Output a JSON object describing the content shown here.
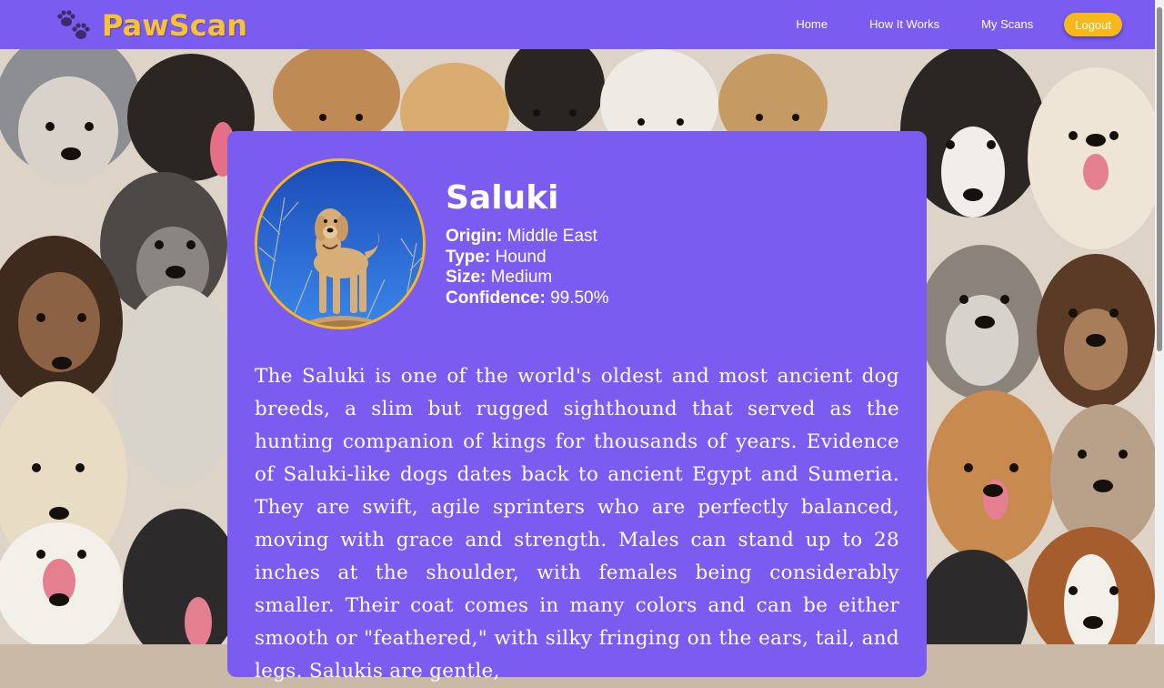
{
  "app": {
    "brand": "PawScan",
    "logo_icon": "paw-prints-icon",
    "accent": "#7a5cf0",
    "brand_color": "#f7c32e",
    "button_color": "#f7b81b"
  },
  "nav": {
    "home": "Home",
    "how_it_works": "How It Works",
    "my_scans": "My Scans",
    "logout": "Logout"
  },
  "result": {
    "breed": "Saluki",
    "image_icon": "dog-photo",
    "facts": [
      {
        "label": "Origin:",
        "value": "Middle East"
      },
      {
        "label": "Type:",
        "value": "Hound"
      },
      {
        "label": "Size:",
        "value": "Medium"
      },
      {
        "label": "Confidence:",
        "value": "99.50%"
      }
    ],
    "description": "The Saluki is one of the world's oldest and most ancient dog breeds, a slim but rugged sighthound that served as the hunting companion of kings for thousands of years. Evidence of Saluki-like dogs dates back to ancient Egypt and Sumeria. They are swift, agile sprinters who are perfectly balanced, moving with grace and strength. Males can stand up to 28 inches at the shoulder, with females being considerably smaller. Their coat comes in many colors and can be either smooth or \"feathered,\" with silky fringing on the ears, tail, and legs. Salukis are gentle,"
  }
}
